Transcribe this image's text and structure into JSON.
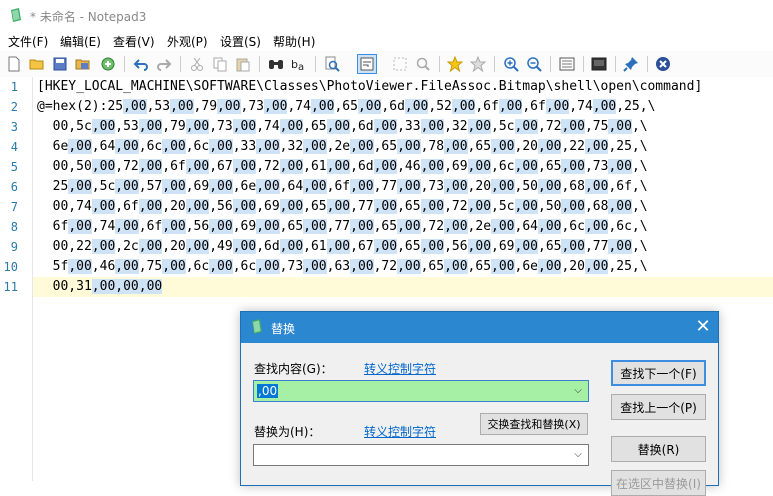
{
  "window": {
    "title": "* 未命名 - Notepad3"
  },
  "menu": [
    {
      "label": "文件(F)"
    },
    {
      "label": "编辑(E)"
    },
    {
      "label": "查看(V)"
    },
    {
      "label": "外观(P)"
    },
    {
      "label": "设置(S)"
    },
    {
      "label": "帮助(H)"
    }
  ],
  "toolbar": {
    "icons": [
      "new-file-icon",
      "open-folder-icon",
      "save-icon",
      "save-as-icon",
      "browse-icon",
      "undo-icon",
      "redo-icon",
      "cut-icon",
      "copy-icon",
      "paste-icon",
      "find-icon",
      "replace-icon",
      "find-next-icon",
      "word-wrap-icon",
      "select-all-icon",
      "zoom-search-icon",
      "favorite-icon",
      "add-favorite-icon",
      "zoom-in-icon",
      "zoom-out-icon",
      "schema-icon",
      "customize-schema-icon",
      "pin-icon",
      "exit-icon"
    ]
  },
  "editor": {
    "line_numbers": [
      "1",
      "2",
      "3",
      "4",
      "5",
      "6",
      "7",
      "8",
      "9",
      "10",
      "11"
    ],
    "lines": [
      "[HKEY_LOCAL_MACHINE\\SOFTWARE\\Classes\\PhotoViewer.FileAssoc.Bitmap\\shell\\open\\command]",
      "@=hex(2):25,00,53,00,79,00,73,00,74,00,65,00,6d,00,52,00,6f,00,6f,00,74,00,25,\\",
      "  00,5c,00,53,00,79,00,73,00,74,00,65,00,6d,00,33,00,32,00,5c,00,72,00,75,00,\\",
      "  6e,00,64,00,6c,00,6c,00,33,00,32,00,2e,00,65,00,78,00,65,00,20,00,22,00,25,\\",
      "  00,50,00,72,00,6f,00,67,00,72,00,61,00,6d,00,46,00,69,00,6c,00,65,00,73,00,\\",
      "  25,00,5c,00,57,00,69,00,6e,00,64,00,6f,00,77,00,73,00,20,00,50,00,68,00,6f,\\",
      "  00,74,00,6f,00,20,00,56,00,69,00,65,00,77,00,65,00,72,00,5c,00,50,00,68,00,\\",
      "  6f,00,74,00,6f,00,56,00,69,00,65,00,77,00,65,00,72,00,2e,00,64,00,6c,00,6c,\\",
      "  00,22,00,2c,00,20,00,49,00,6d,00,61,00,67,00,65,00,56,00,69,00,65,00,77,00,\\",
      "  5f,00,46,00,75,00,6c,00,6c,00,73,00,63,00,72,00,65,00,65,00,6e,00,20,00,25,\\",
      "  00,31,00,00,00"
    ],
    "highlight_token": ",00"
  },
  "dialog": {
    "title": "替换",
    "find_label": "查找内容(G)：",
    "find_escape_link": "转义控制字符",
    "find_value": ",00",
    "replace_label": "替换为(H)：",
    "replace_escape_link": "转义控制字符",
    "replace_value": "",
    "swap_button": "交换查找和替换(X)",
    "find_next_button": "查找下一个(F)",
    "find_prev_button": "查找上一个(P)",
    "replace_button": "替换(R)",
    "replace_in_sel_button": "在选区中替换(I)",
    "close": "✕"
  },
  "colors": {
    "highlight": "#cfe3f7",
    "find_field": "#a6f0a6",
    "dialog_title": "#2b87cf",
    "line_numbers": "#2b7aa8",
    "current_line": "#fffbd8"
  }
}
